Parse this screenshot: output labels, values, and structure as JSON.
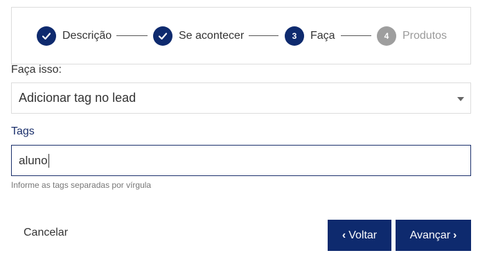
{
  "stepper": {
    "steps": [
      {
        "label": "Descrição",
        "status": "done",
        "number": ""
      },
      {
        "label": "Se acontecer",
        "status": "done",
        "number": ""
      },
      {
        "label": "Faça",
        "status": "active",
        "number": "3"
      },
      {
        "label": "Produtos",
        "status": "pending",
        "number": "4"
      }
    ]
  },
  "form": {
    "action_label": "Faça isso:",
    "action_value": "Adicionar tag no lead",
    "tags_label": "Tags",
    "tags_value": "aluno",
    "tags_hint": "Informe as tags separadas por vírgula"
  },
  "footer": {
    "cancel_label": "Cancelar",
    "back_label": "Voltar",
    "next_label": "Avançar",
    "back_icon": "chevron-left-icon",
    "next_icon": "chevron-right-icon"
  },
  "colors": {
    "primary": "#0e2a6e",
    "pending": "#9e9e9e",
    "label_accent": "#1a2f6b"
  }
}
